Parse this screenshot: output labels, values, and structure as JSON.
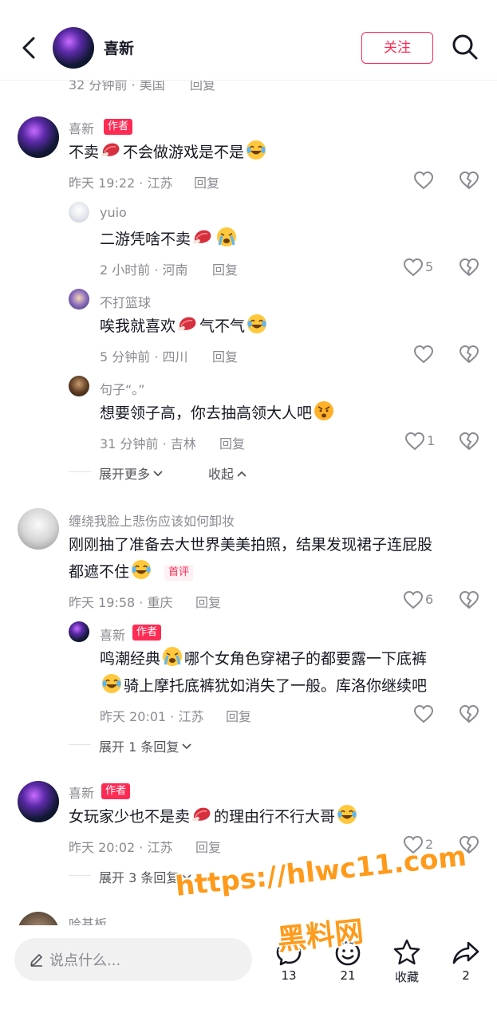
{
  "header": {
    "name": "喜新",
    "follow_label": "关注"
  },
  "top_partial": {
    "meta": "32 分钟前 · 美国",
    "reply": "回复"
  },
  "c1": {
    "name": "喜新",
    "tag": "作者",
    "text_a": "不卖",
    "text_b": "不会做游戏是不是",
    "meta": "昨天 19:22 · 江苏",
    "reply": "回复",
    "replies": [
      {
        "name": "yuio",
        "text_a": "二游凭啥不卖",
        "meta": "2 小时前 · 河南",
        "reply": "回复",
        "likes": "5"
      },
      {
        "name": "不打篮球",
        "text_a": "唉我就喜欢",
        "text_b": "气不气",
        "meta": "5 分钟前 · 四川",
        "reply": "回复"
      },
      {
        "name": "句子“。”",
        "text_a": "想要领子高，你去抽高领大人吧",
        "meta": "31 分钟前 · 吉林",
        "reply": "回复",
        "likes": "1"
      }
    ],
    "expand_more": "展开更多",
    "collapse": "收起"
  },
  "c2": {
    "name": "缠绕我脸上悲伤应该如何卸妆",
    "text_line1": "刚刚抽了准备去大世界美美拍照，结果发现裙子连屁股",
    "text_line2": "都遮不住",
    "first_tag": "首评",
    "meta": "昨天 19:58 · 重庆",
    "reply": "回复",
    "likes": "6",
    "reply1": {
      "name": "喜新",
      "tag": "作者",
      "line1_a": "鸣潮经典",
      "line1_b": "哪个女角色穿裙子的都要露一下底裤",
      "line2": "骑上摩托底裤犹如消失了一般。库洛你继续吧",
      "meta": "昨天 20:01 · 江苏",
      "reply": "回复"
    },
    "expand": "展开 1 条回复"
  },
  "c3": {
    "name": "喜新",
    "tag": "作者",
    "text_a": "女玩家少也不是卖",
    "text_b": "的理由行不行大哥",
    "meta": "昨天 20:02 · 江苏",
    "reply": "回复",
    "likes": "2",
    "expand": "展开 3 条回复"
  },
  "c4": {
    "name": "哈基板"
  },
  "bottom": {
    "placeholder": "说点什么...",
    "comments_count": "13",
    "emoji_count": "21",
    "collect_label": "收藏",
    "share_count": "2"
  },
  "watermark": {
    "line1": "https://hlwc11.com",
    "line2": "黑料网"
  },
  "colors": {
    "accent": "#fe2c55",
    "muted": "#8a8b91",
    "text": "#161823"
  }
}
